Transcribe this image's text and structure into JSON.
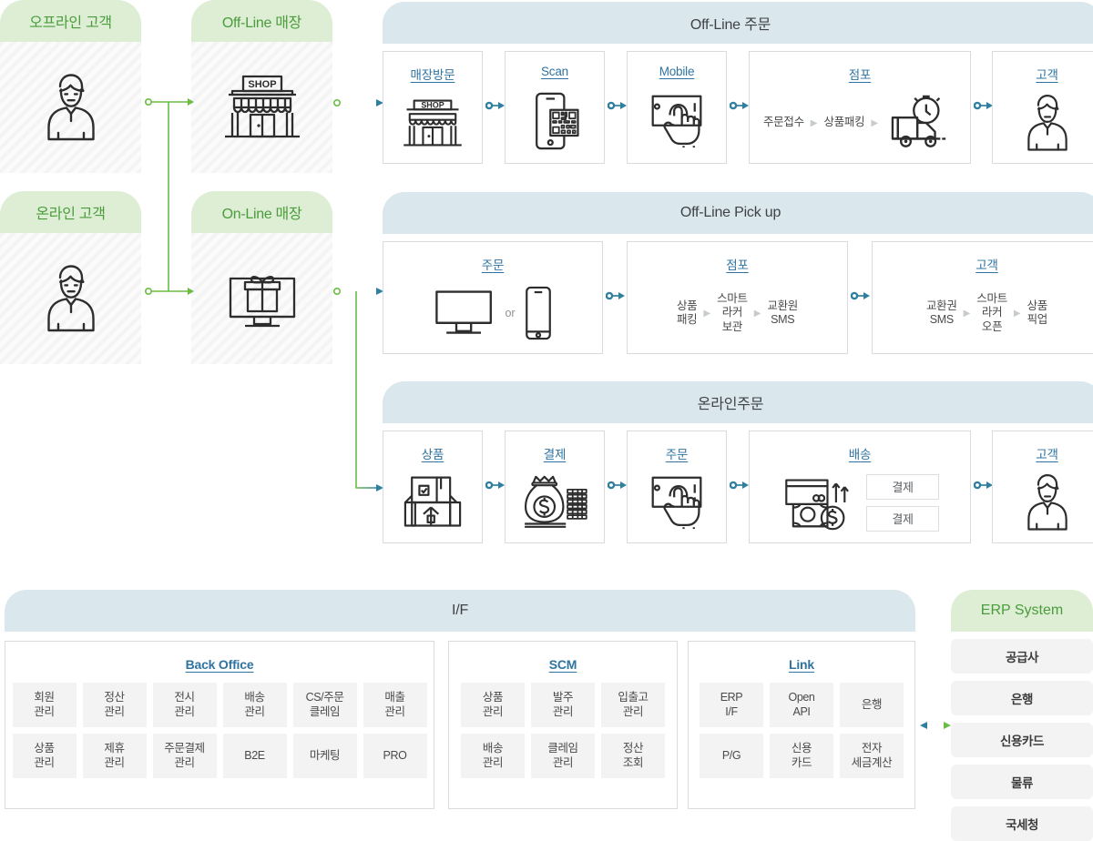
{
  "actors": [
    {
      "label": "오프라인 고객",
      "icon": "person-icon",
      "name": "offline-customer"
    },
    {
      "label": "Off-Line 매장",
      "icon": "shop-icon",
      "name": "offline-store"
    },
    {
      "label": "온라인 고객",
      "icon": "person-icon",
      "name": "online-customer"
    },
    {
      "label": "On-Line 매장",
      "icon": "gift-monitor-icon",
      "name": "online-store"
    }
  ],
  "sections": {
    "offline_order": "Off-Line 주문",
    "offline_pickup": "Off-Line Pick up",
    "online_order": "온라인주문",
    "interface": "I/F"
  },
  "offline_order_steps": [
    {
      "caption": "매장방문",
      "icon": "shop-front-icon"
    },
    {
      "caption": "Scan",
      "icon": "qr-scan-phone-icon"
    },
    {
      "caption": "Mobile",
      "icon": "hand-tap-phone-icon"
    },
    {
      "caption": "점포",
      "icon": "delivery-truck-clock-icon",
      "steps": [
        "주문접수",
        "상품패킹"
      ]
    },
    {
      "caption": "고객",
      "icon": "person-icon"
    }
  ],
  "offline_pickup_steps": [
    {
      "caption": "주문",
      "icon": "monitor-or-phone-icon",
      "or_label": "or"
    },
    {
      "caption": "점포",
      "steps": [
        "상품\n패킹",
        "스마트\n라커\n보관",
        "교환원\nSMS"
      ]
    },
    {
      "caption": "고객",
      "steps": [
        "교환권\nSMS",
        "스마트\n라커\n오픈",
        "상품\n픽업"
      ]
    }
  ],
  "online_order_steps": [
    {
      "caption": "상품",
      "icon": "box-check-icon"
    },
    {
      "caption": "결제",
      "icon": "money-bag-coins-icon"
    },
    {
      "caption": "주문",
      "icon": "hand-tap-phone-icon"
    },
    {
      "caption": "배송",
      "icon": "card-cash-icon",
      "pills": [
        "결제",
        "결제"
      ]
    },
    {
      "caption": "고객",
      "icon": "person-icon"
    }
  ],
  "if_groups": [
    {
      "title": "Back Office",
      "cells": [
        "회원\n관리",
        "정산\n관리",
        "전시\n관리",
        "배송\n관리",
        "CS/주문\n클레임",
        "매출\n관리",
        "상품\n관리",
        "제휴\n관리",
        "주문결제\n관리",
        "B2E",
        "마케팅",
        "PRO"
      ]
    },
    {
      "title": "SCM",
      "cells": [
        "상품\n관리",
        "발주\n관리",
        "입출고\n관리",
        "배송\n관리",
        "클레임\n관리",
        "정산\n조회"
      ]
    },
    {
      "title": "Link",
      "cells": [
        "ERP\nI/F",
        "Open\nAPI",
        "은행",
        "P/G",
        "신용\n카드",
        "전자\n세금계산"
      ]
    }
  ],
  "erp": {
    "title": "ERP System",
    "items": [
      "공급사",
      "은행",
      "신용카드",
      "물류",
      "국세청"
    ]
  },
  "colors": {
    "green_accent": "#4a9c3c",
    "green_header_bg": "#ddeed4",
    "blue_header_bg": "#dae7ec",
    "caption_blue": "#2f73a0",
    "connector_blue": "#2f7fa0",
    "connector_green": "#6cbd45",
    "icon_stroke": "#2d2d2d"
  }
}
